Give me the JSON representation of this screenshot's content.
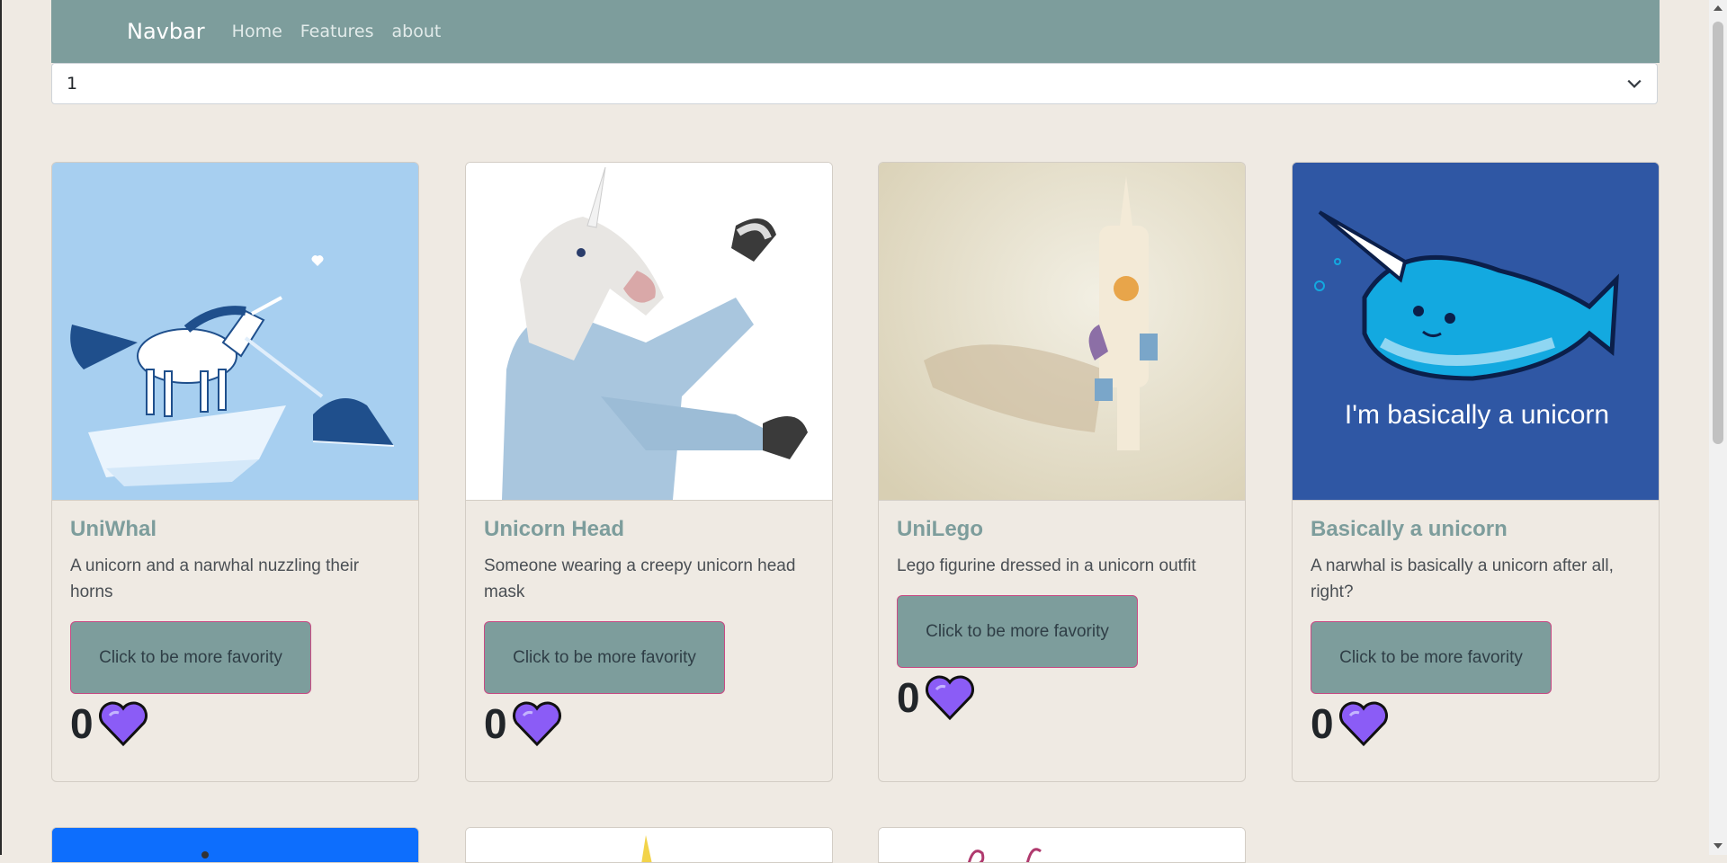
{
  "navbar": {
    "brand": "Navbar",
    "links": [
      "Home",
      "Features",
      "about"
    ],
    "bg_color": "#7d9d9c"
  },
  "select": {
    "value": "1",
    "icon": "chevron-down-icon"
  },
  "cards": [
    {
      "title": "UniWhal",
      "text": "A unicorn and a narwhal nuzzling their horns",
      "button": "Click to be more favority",
      "count": "0",
      "icon": "heart-icon"
    },
    {
      "title": "Unicorn Head",
      "text": "Someone wearing a creepy unicorn head mask",
      "button": "Click to be more favority",
      "count": "0",
      "icon": "heart-icon"
    },
    {
      "title": "UniLego",
      "text": "Lego figurine dressed in a unicorn outfit",
      "button": "Click to be more favority",
      "count": "0",
      "icon": "heart-icon"
    },
    {
      "title": "Basically a unicorn",
      "text": "A narwhal is basically a unicorn after all, right?",
      "button": "Click to be more favority",
      "count": "0",
      "icon": "heart-icon"
    }
  ],
  "image_texts": {
    "narwhal_caption": "I'm basically a unicorn"
  },
  "colors": {
    "accent": "#7d9d9c",
    "button_border": "#c94a84",
    "heart": "#8b5cf6",
    "page_bg": "#efeae3"
  }
}
